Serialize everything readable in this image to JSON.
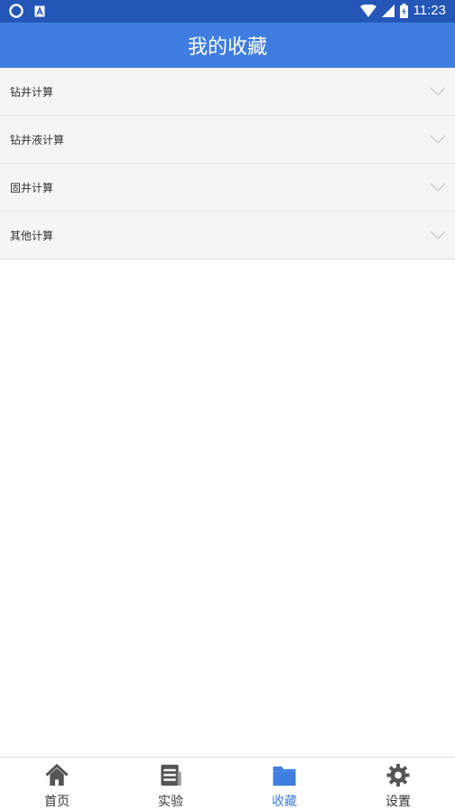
{
  "statusbar": {
    "time": "11:23"
  },
  "appbar": {
    "title": "我的收藏"
  },
  "list": {
    "items": [
      {
        "label": "钻井计算"
      },
      {
        "label": "钻井液计算"
      },
      {
        "label": "固井计算"
      },
      {
        "label": "其他计算"
      }
    ]
  },
  "tabbar": {
    "tabs": [
      {
        "label": "首页",
        "icon": "home-icon"
      },
      {
        "label": "实验",
        "icon": "document-icon"
      },
      {
        "label": "收藏",
        "icon": "folder-icon",
        "active": true
      },
      {
        "label": "设置",
        "icon": "gear-icon"
      }
    ]
  },
  "colors": {
    "primary": "#3f7de0",
    "statusbar": "#2456b8",
    "row_bg": "#f5f5f5"
  }
}
